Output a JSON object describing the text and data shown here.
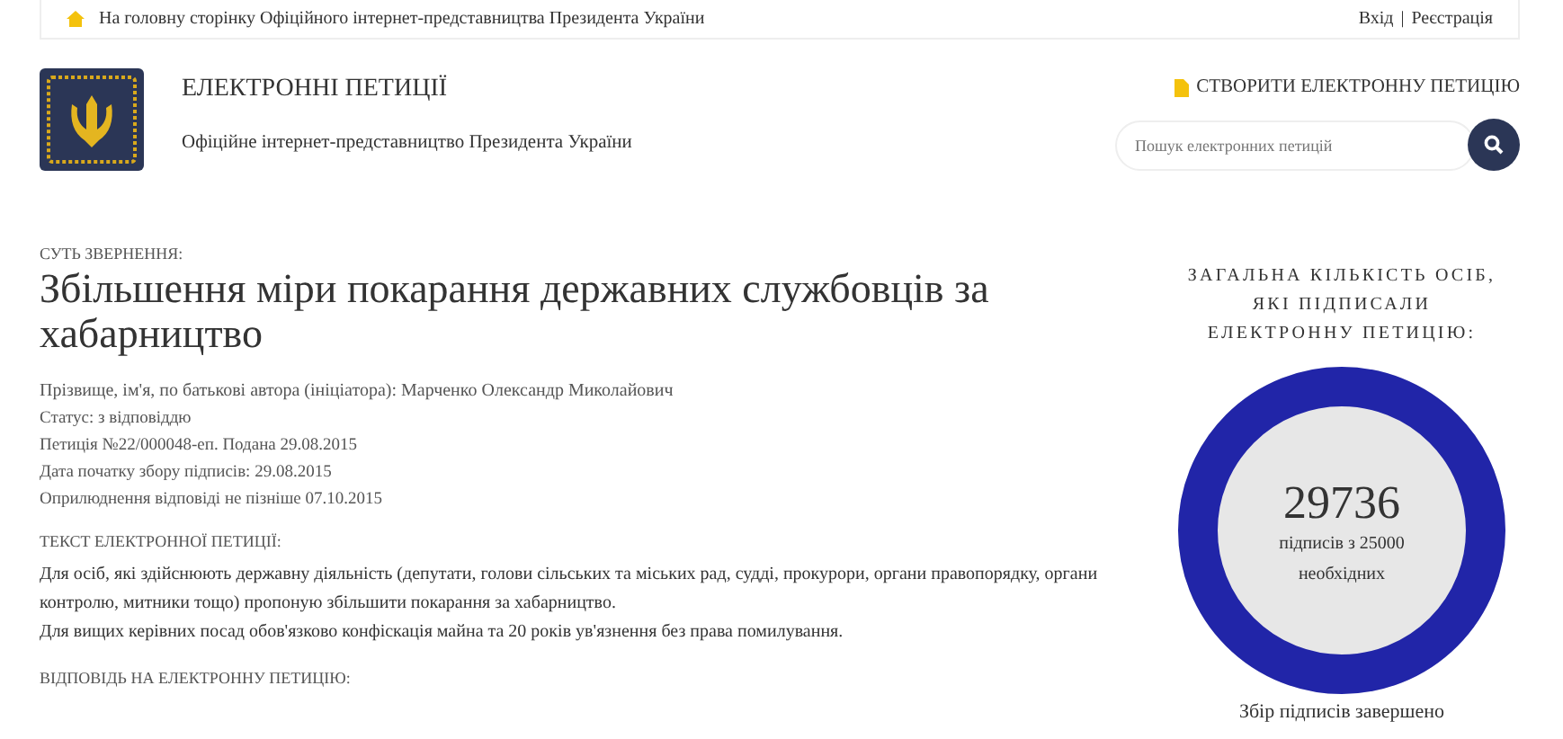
{
  "top_bar": {
    "home_link": "На головну сторінку Офіційного інтернет-представництва Президента України",
    "login": "Вхід",
    "separator": "|",
    "register": "Реєстрація"
  },
  "header": {
    "title": "ЕЛЕКТРОННІ ПЕТИЦІЇ",
    "subtitle": "Офіційне інтернет-представництво Президента України",
    "create_link": "СТВОРИТИ ЕЛЕКТРОННУ ПЕТИЦІЮ",
    "search": {
      "placeholder": "Пошук електронних петицій"
    }
  },
  "petition": {
    "subject_label": "СУТЬ ЗВЕРНЕННЯ:",
    "title": "Збільшення міри покарання державних службовців за хабарництво",
    "meta": [
      "Прізвище, ім'я, по батькові автора (ініціатора): Марченко Олександр Миколайович",
      "Статус: з відповіддю",
      "Петиція №22/000048-еп. Подана 29.08.2015",
      "Дата початку збору підписів: 29.08.2015",
      "Оприлюднення відповіді не пізніше 07.10.2015"
    ],
    "text_label": "ТЕКСТ ЕЛЕКТРОННОЇ ПЕТИЦІЇ:",
    "text": [
      "Для осіб, які здійснюють державну діяльність (депутати, голови сільських та міських рад, судді, прокурори, органи правопорядку, органи контролю, митники тощо) пропоную збільшити покарання за хабарництво.",
      "Для вищих керівних посад обов'язково конфіскація майна та 20 років ув'язнення без права помилування."
    ],
    "answer_label": "ВІДПОВІДЬ НА ЕЛЕКТРОННУ ПЕТИЦІЮ:"
  },
  "signatures": {
    "heading": "ЗАГАЛЬНА КІЛЬКІСТЬ ОСІБ, ЯКІ ПІДПИСАЛИ ЕЛЕКТРОННУ ПЕТИЦІЮ:",
    "count": "29736",
    "caption": "підписів з 25000 необхідних",
    "level": 1,
    "status": "Збір підписів завершено"
  }
}
